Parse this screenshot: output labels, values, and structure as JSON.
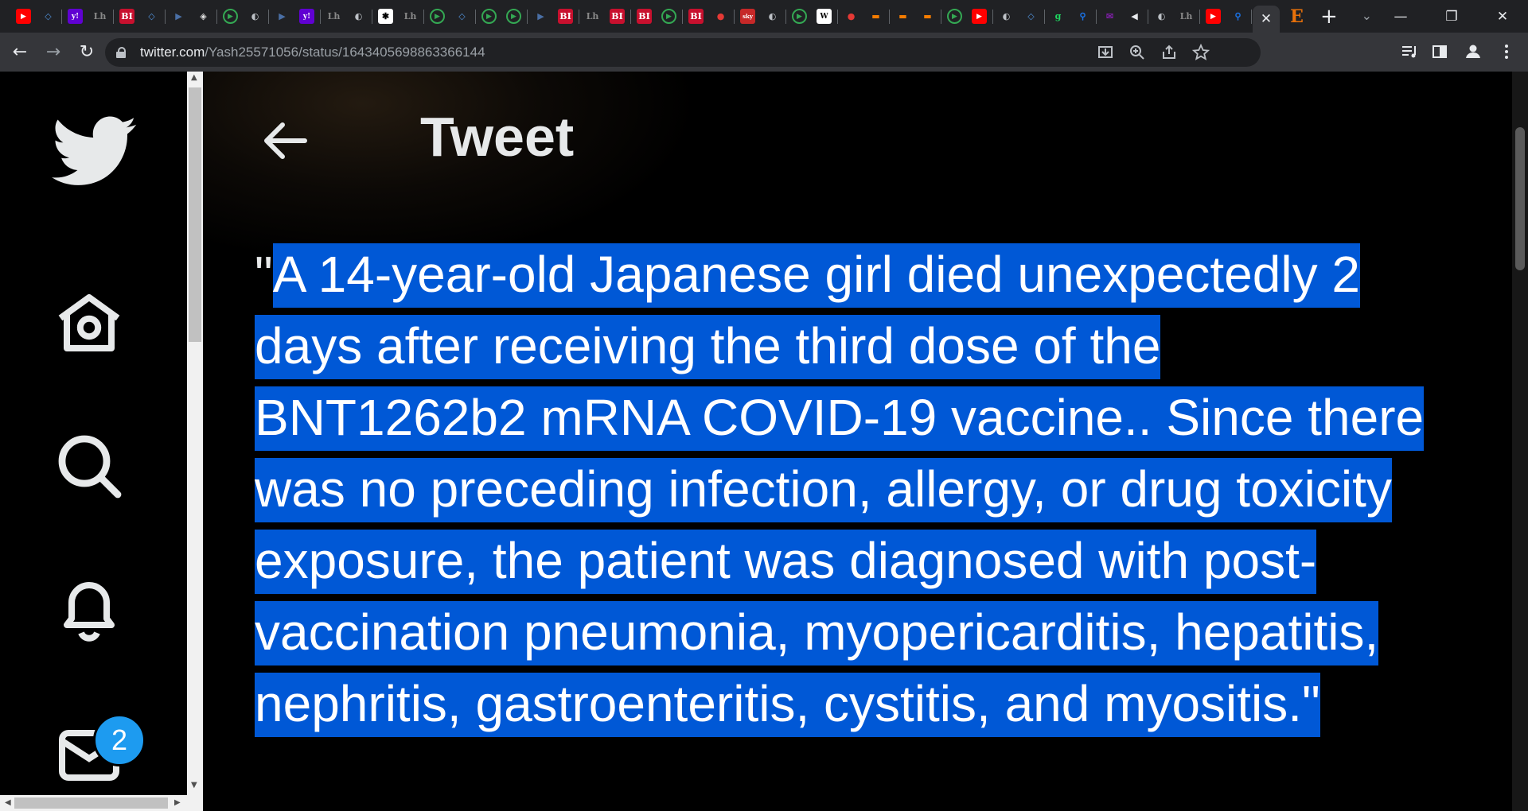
{
  "browser": {
    "tab_favicons": [
      {
        "name": "youtube",
        "color": "#ff0000",
        "glyph": "▶"
      },
      {
        "name": "shield",
        "color": "#4f8fd6",
        "glyph": "◇"
      },
      {
        "name": "yahoo",
        "color": "#6001d2",
        "glyph": "y!"
      },
      {
        "name": "sh",
        "color": "#888888",
        "glyph": "Lh"
      },
      {
        "name": "bi",
        "color": "#c8102e",
        "glyph": "BI"
      },
      {
        "name": "shield",
        "color": "#4f8fd6",
        "glyph": "◇"
      },
      {
        "name": "arrow",
        "color": "#4a6fa5",
        "glyph": "▶"
      },
      {
        "name": "maps",
        "color": "#e0e0e0",
        "glyph": "◈"
      },
      {
        "name": "play",
        "color": "#34a853",
        "glyph": "▶"
      },
      {
        "name": "globe",
        "color": "#bdc1c6",
        "glyph": "◐"
      },
      {
        "name": "arrow",
        "color": "#4a6fa5",
        "glyph": "▶"
      },
      {
        "name": "yahoo",
        "color": "#6001d2",
        "glyph": "y!"
      },
      {
        "name": "sh",
        "color": "#888888",
        "glyph": "Lh"
      },
      {
        "name": "globe",
        "color": "#bdc1c6",
        "glyph": "◐"
      },
      {
        "name": "figure",
        "color": "#ffffff",
        "glyph": "✱"
      },
      {
        "name": "sh",
        "color": "#888888",
        "glyph": "Lh"
      },
      {
        "name": "play",
        "color": "#34a853",
        "glyph": "▶"
      },
      {
        "name": "shield",
        "color": "#4f8fd6",
        "glyph": "◇"
      },
      {
        "name": "play",
        "color": "#34a853",
        "glyph": "▶"
      },
      {
        "name": "play",
        "color": "#34a853",
        "glyph": "▶"
      },
      {
        "name": "arrow",
        "color": "#4a6fa5",
        "glyph": "▶"
      },
      {
        "name": "bi",
        "color": "#c8102e",
        "glyph": "BI"
      },
      {
        "name": "sh",
        "color": "#888888",
        "glyph": "Lh"
      },
      {
        "name": "bi",
        "color": "#c8102e",
        "glyph": "BI"
      },
      {
        "name": "bi",
        "color": "#c8102e",
        "glyph": "BI"
      },
      {
        "name": "play",
        "color": "#34a853",
        "glyph": "▶"
      },
      {
        "name": "bi",
        "color": "#c8102e",
        "glyph": "BI"
      },
      {
        "name": "mic",
        "color": "#e53935",
        "glyph": "●"
      },
      {
        "name": "sky",
        "color": "#c62828",
        "glyph": "sky"
      },
      {
        "name": "globe",
        "color": "#bdc1c6",
        "glyph": "◐"
      },
      {
        "name": "play",
        "color": "#34a853",
        "glyph": "▶"
      },
      {
        "name": "wsj",
        "color": "#ffffff",
        "glyph": "W"
      },
      {
        "name": "mic",
        "color": "#e53935",
        "glyph": "●"
      },
      {
        "name": "bookmark",
        "color": "#f57c00",
        "glyph": "▬"
      },
      {
        "name": "bookmark",
        "color": "#f57c00",
        "glyph": "▬"
      },
      {
        "name": "bookmark",
        "color": "#f57c00",
        "glyph": "▬"
      },
      {
        "name": "play",
        "color": "#34a853",
        "glyph": "▶"
      },
      {
        "name": "youtube",
        "color": "#ff0000",
        "glyph": "▶"
      },
      {
        "name": "globe",
        "color": "#bdc1c6",
        "glyph": "◐"
      },
      {
        "name": "shield",
        "color": "#4f8fd6",
        "glyph": "◇"
      },
      {
        "name": "g",
        "color": "#1ed760",
        "glyph": "g"
      },
      {
        "name": "search",
        "color": "#1a73e8",
        "glyph": "⚲"
      },
      {
        "name": "mail",
        "color": "#7b1fa2",
        "glyph": "✉"
      },
      {
        "name": "sound",
        "color": "#e8eaed",
        "glyph": "◀"
      },
      {
        "name": "globe",
        "color": "#bdc1c6",
        "glyph": "◐"
      },
      {
        "name": "sh",
        "color": "#888888",
        "glyph": "Lh"
      },
      {
        "name": "youtube",
        "color": "#ff0000",
        "glyph": "▶"
      },
      {
        "name": "search",
        "color": "#1a73e8",
        "glyph": "⚲"
      }
    ],
    "active_tab_close": "✕",
    "last_tab_glyph": "E",
    "new_tab": "+",
    "tab_search": "⌄",
    "window": {
      "minimize": "—",
      "restore": "❐",
      "close": "✕"
    },
    "nav": {
      "back": "←",
      "forward": "→",
      "reload": "↻"
    },
    "url_host": "twitter.com",
    "url_path": "/Yash25571056/status/1643405698863366144",
    "toolbar_icons": [
      "install",
      "zoom",
      "share",
      "bookmark-star",
      "media",
      "side-panel",
      "profile",
      "menu"
    ]
  },
  "sidebar": {
    "items": [
      "twitter-logo",
      "home",
      "explore",
      "notifications",
      "messages"
    ],
    "messages_badge": "2"
  },
  "header": {
    "title": "Tweet"
  },
  "tweet": {
    "lines": [
      "\"A 14-year-old Japanese girl died unexpectedly 2 ",
      "days after receiving the third dose of the ",
      "BNT1262b2 mRNA COVID-19 vaccine.. Since there ",
      "was no preceding infection, allergy, or drug toxicity ",
      "exposure, the patient was diagnosed with post-",
      "vaccination pneumonia, myopericarditis, hepatitis, ",
      "nephritis, gastroenteritis, cystitis, and myositis.\""
    ],
    "selection_color": "#0058d6"
  }
}
